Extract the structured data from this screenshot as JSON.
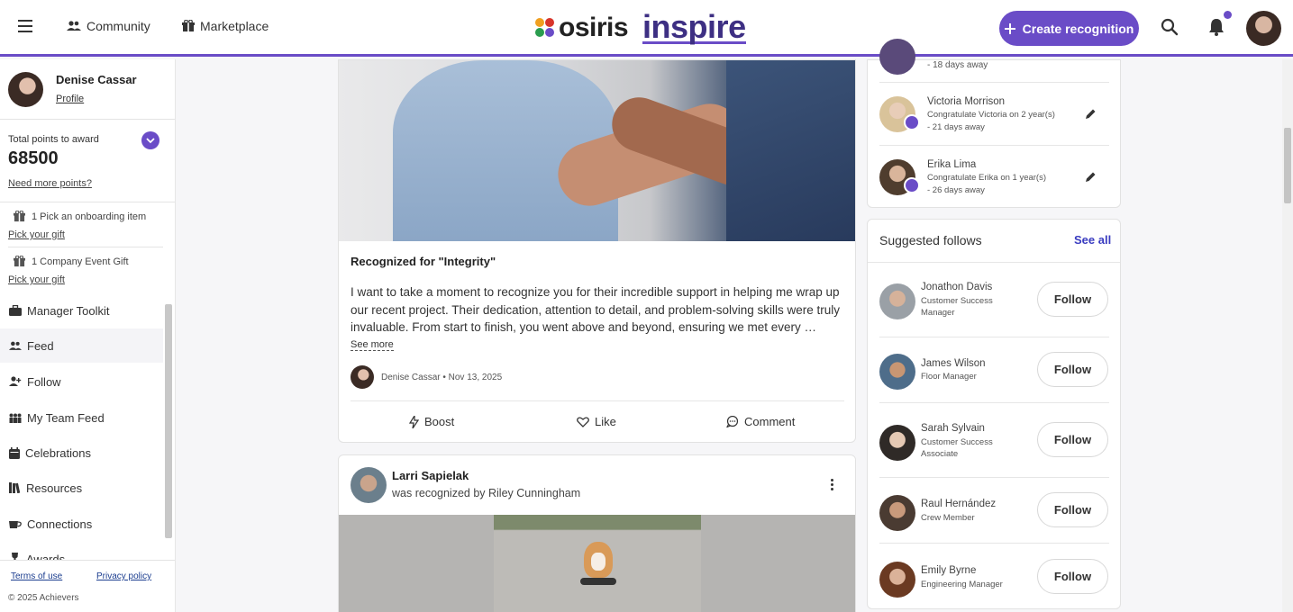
{
  "header": {
    "community": "Community",
    "marketplace": "Marketplace",
    "logo_left": "osiris",
    "logo_right": "inspire",
    "create": "Create recognition",
    "icons": [
      "menu-icon",
      "people-icon",
      "gift-icon",
      "search-icon",
      "bell-icon",
      "plus-icon"
    ],
    "accent": "#6a4cc7"
  },
  "sidebar": {
    "name": "Denise Cassar",
    "profile": "Profile",
    "points_label": "Total points to award",
    "points": "68500",
    "need_more": "Need more points?",
    "gifts": [
      {
        "label": "1 Pick an onboarding item",
        "link": "Pick your gift"
      },
      {
        "label": "1 Company Event Gift",
        "link": "Pick your gift"
      }
    ],
    "nav": [
      {
        "label": "Manager Toolkit",
        "icon": "briefcase-icon"
      },
      {
        "label": "Feed",
        "icon": "people-icon"
      },
      {
        "label": "Follow",
        "icon": "person-add-icon"
      },
      {
        "label": "My Team Feed",
        "icon": "team-icon"
      },
      {
        "label": "Celebrations",
        "icon": "calendar-icon"
      },
      {
        "label": "Resources",
        "icon": "books-icon"
      },
      {
        "label": "Connections",
        "icon": "coffee-icon"
      },
      {
        "label": "Awards",
        "icon": "trophy-icon"
      }
    ],
    "terms": "Terms of use",
    "privacy": "Privacy policy",
    "copyright": "© 2025 Achievers"
  },
  "post1": {
    "title": "Recognized for \"Integrity\"",
    "body": "I want to take a moment to recognize you for their incredible support in helping me wrap up our recent project. Their dedication, attention to detail, and problem-solving skills were truly invaluable. From start to finish, you went above and beyond, ensuring we met every …",
    "see_more": "See more",
    "meta": "Denise Cassar • Nov 13, 2025",
    "boost": "Boost",
    "like": "Like",
    "comment": "Comment"
  },
  "post2": {
    "name": "Larri Sapielak",
    "sub": "was recognized by Riley Cunningham"
  },
  "celebrations": {
    "top_line": "- 18 days away",
    "items": [
      {
        "name": "Victoria Morrison",
        "line1": "Congratulate Victoria on 2 year(s)",
        "line2": "- 21 days away"
      },
      {
        "name": "Erika Lima",
        "line1": "Congratulate Erika on 1 year(s)",
        "line2": "- 26 days away"
      }
    ]
  },
  "suggested": {
    "title": "Suggested follows",
    "see_all": "See all",
    "follow": "Follow",
    "people": [
      {
        "name": "Jonathon Davis",
        "role": "Customer Success Manager"
      },
      {
        "name": "James Wilson",
        "role": "Floor Manager"
      },
      {
        "name": "Sarah Sylvain",
        "role": "Customer Success Associate"
      },
      {
        "name": "Raul Hernández",
        "role": "Crew Member"
      },
      {
        "name": "Emily Byrne",
        "role": "Engineering Manager"
      }
    ]
  }
}
